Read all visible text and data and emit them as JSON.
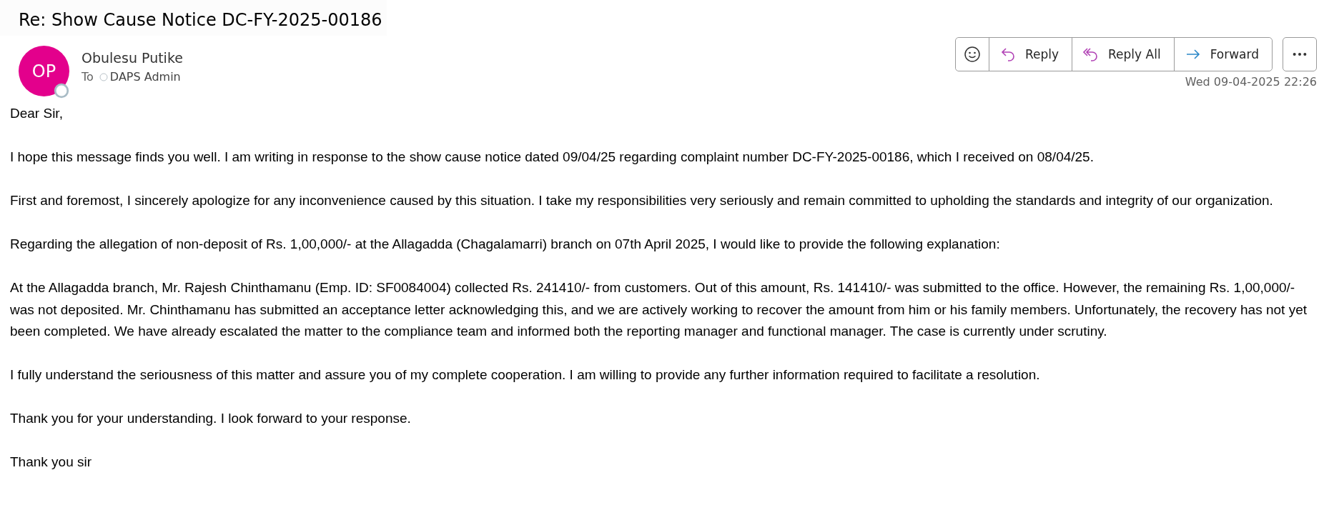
{
  "subject": "Re: Show Cause Notice DC-FY-2025-00186",
  "sender": {
    "initials": "OP",
    "name": "Obulesu Putike",
    "to_label": "To",
    "recipient": "DAPS Admin"
  },
  "actions": [
    {
      "kind": "react"
    },
    {
      "kind": "reply",
      "label": "Reply"
    },
    {
      "kind": "reply_all",
      "label": "Reply All"
    },
    {
      "kind": "forward",
      "label": "Forward"
    }
  ],
  "timestamp": "Wed 09-04-2025 22:26",
  "body": [
    "Dear Sir,",
    "I hope this message finds you well. I am writing in response to the show cause notice dated 09/04/25 regarding complaint number DC-FY-2025-00186, which I received on 08/04/25.",
    "First and foremost, I sincerely apologize for any inconvenience caused by this situation. I take my responsibilities very seriously and remain committed to upholding the standards and integrity of our organization.",
    "Regarding the allegation of non-deposit of Rs. 1,00,000/- at the Allagadda (Chagalamarri) branch on 07th April 2025, I would like to provide the following explanation:",
    "At the Allagadda branch, Mr. Rajesh Chinthamanu (Emp. ID: SF0084004) collected Rs. 241410/- from customers. Out of this amount, Rs. 141410/- was submitted to the office. However, the remaining Rs. 1,00,000/- was not deposited. Mr. Chinthamanu has submitted an acceptance letter acknowledging this, and we are actively working to recover the amount from him or his family members. Unfortunately, the recovery has not yet been completed. We have already escalated the matter to the compliance team and informed both the reporting manager and functional manager. The case is currently under scrutiny.",
    "I fully understand the seriousness of this matter and assure you of my complete cooperation. I am willing to provide any further information required to facilitate a resolution.",
    "Thank you for your understanding. I look forward to your response.",
    "Thank you sir"
  ]
}
